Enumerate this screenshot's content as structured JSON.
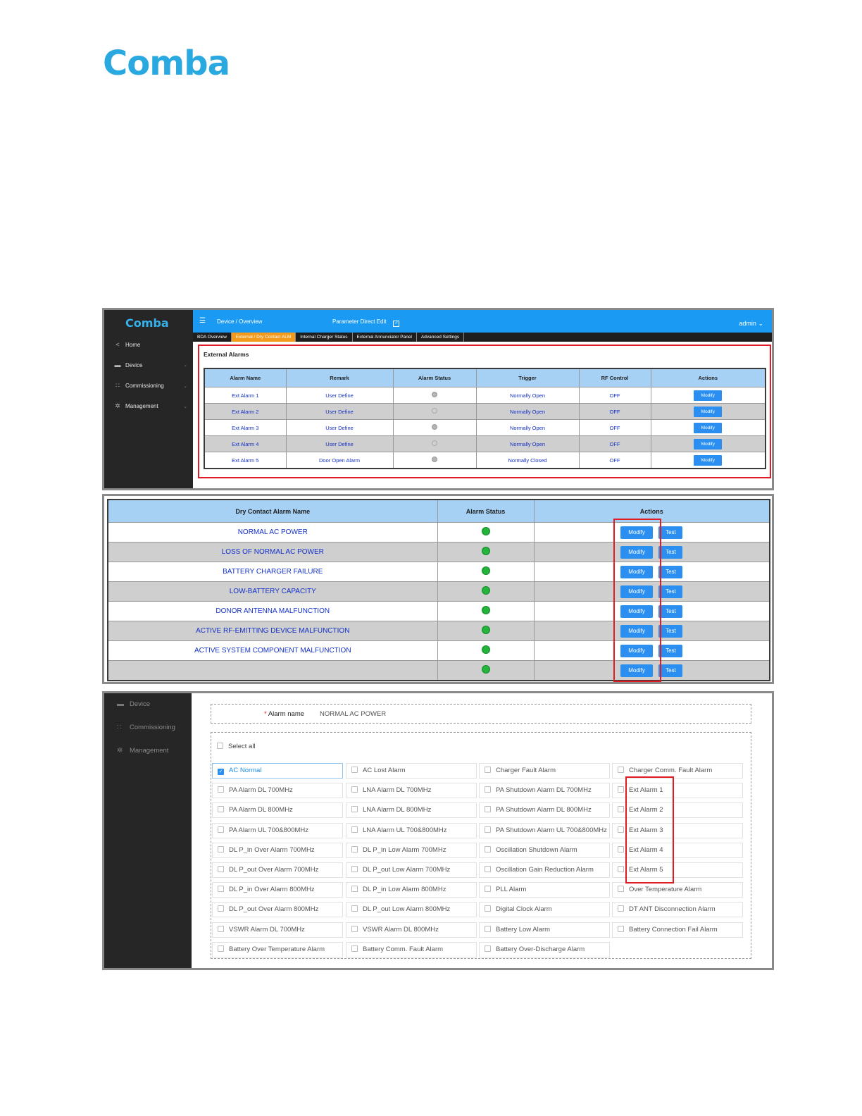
{
  "logo": {
    "text": "Comba",
    "color": "#2aa8e0"
  },
  "panel1": {
    "sidebar": {
      "logo": "Comba",
      "items": [
        {
          "label": "Home",
          "icon": "share-icon"
        },
        {
          "label": "Device",
          "icon": "monitor-icon"
        },
        {
          "label": "Commissioning",
          "icon": "grid-icon"
        },
        {
          "label": "Management",
          "icon": "gear-icon"
        }
      ]
    },
    "topbar": {
      "breadcrumb": "Device  /  Overview",
      "parameter_direct_edit": "Parameter Direct Edit",
      "checkbox": "✓",
      "user": "admin"
    },
    "tabs": [
      "BDA Overview",
      "External / Dry Contact ALM",
      "Internal Charger Status",
      "External Annunciator Panel",
      "Advanced Settings"
    ],
    "section_title": "External Alarms",
    "table": {
      "headers": [
        "Alarm Name",
        "Remark",
        "Alarm Status",
        "Trigger",
        "RF Control",
        "Actions"
      ],
      "rows": [
        {
          "name": "Ext Alarm 1",
          "remark": "User Define",
          "status": "grey",
          "trigger": "Normally Open",
          "rf": "OFF",
          "action": "Modify"
        },
        {
          "name": "Ext Alarm 2",
          "remark": "User Define",
          "status": "empty",
          "trigger": "Normally Open",
          "rf": "OFF",
          "action": "Modify"
        },
        {
          "name": "Ext Alarm 3",
          "remark": "User Define",
          "status": "grey",
          "trigger": "Normally Open",
          "rf": "OFF",
          "action": "Modify"
        },
        {
          "name": "Ext Alarm 4",
          "remark": "User Define",
          "status": "empty",
          "trigger": "Normally Open",
          "rf": "OFF",
          "action": "Modify"
        },
        {
          "name": "Ext Alarm 5",
          "remark": "Door Open Alarm",
          "status": "grey",
          "trigger": "Normally Closed",
          "rf": "OFF",
          "action": "Modify"
        }
      ]
    }
  },
  "panel2": {
    "headers": [
      "Dry Contact Alarm Name",
      "Alarm Status",
      "Actions"
    ],
    "modify_label": "Modify",
    "test_label": "Test",
    "rows": [
      "NORMAL AC POWER",
      "LOSS OF NORMAL AC POWER",
      "BATTERY CHARGER FAILURE",
      "LOW-BATTERY CAPACITY",
      "DONOR ANTENNA MALFUNCTION",
      "ACTIVE RF-EMITTING DEVICE MALFUNCTION",
      "ACTIVE SYSTEM COMPONENT MALFUNCTION",
      ""
    ]
  },
  "panel3": {
    "sidebar": [
      {
        "label": "Device",
        "icon": "monitor-icon"
      },
      {
        "label": "Commissioning",
        "icon": "grid-icon"
      },
      {
        "label": "Management",
        "icon": "gear-icon"
      }
    ],
    "alarm_name_label": "Alarm name",
    "required_mark": "*",
    "alarm_name_value": "NORMAL AC POWER",
    "select_all": "Select all",
    "options": [
      [
        "AC Normal",
        "AC Lost Alarm",
        "Charger Fault Alarm",
        "Charger Comm. Fault Alarm"
      ],
      [
        "PA Alarm DL 700MHz",
        "LNA Alarm DL 700MHz",
        "PA Shutdown Alarm DL 700MHz",
        "Ext Alarm 1"
      ],
      [
        "PA Alarm DL 800MHz",
        "LNA Alarm DL 800MHz",
        "PA Shutdown Alarm DL 800MHz",
        "Ext Alarm 2"
      ],
      [
        "PA Alarm UL 700&800MHz",
        "LNA Alarm UL 700&800MHz",
        "PA Shutdown Alarm UL 700&800MHz",
        "Ext Alarm 3"
      ],
      [
        "DL P_in Over Alarm 700MHz",
        "DL P_in Low Alarm 700MHz",
        "Oscillation Shutdown Alarm",
        "Ext Alarm 4"
      ],
      [
        "DL P_out Over Alarm 700MHz",
        "DL P_out Low Alarm 700MHz",
        "Oscillation Gain Reduction Alarm",
        "Ext Alarm 5"
      ],
      [
        "DL P_in Over Alarm 800MHz",
        "DL P_in Low Alarm 800MHz",
        "PLL Alarm",
        "Over Temperature Alarm"
      ],
      [
        "DL P_out Over Alarm 800MHz",
        "DL P_out Low Alarm 800MHz",
        "Digital Clock Alarm",
        "DT ANT Disconnection Alarm"
      ],
      [
        "VSWR Alarm DL 700MHz",
        "VSWR Alarm DL 800MHz",
        "Battery Low Alarm",
        "Battery Connection Fail Alarm"
      ],
      [
        "Battery Over Temperature Alarm",
        "Battery Comm. Fault Alarm",
        "Battery Over-Discharge Alarm",
        ""
      ]
    ],
    "checked": "AC Normal"
  }
}
